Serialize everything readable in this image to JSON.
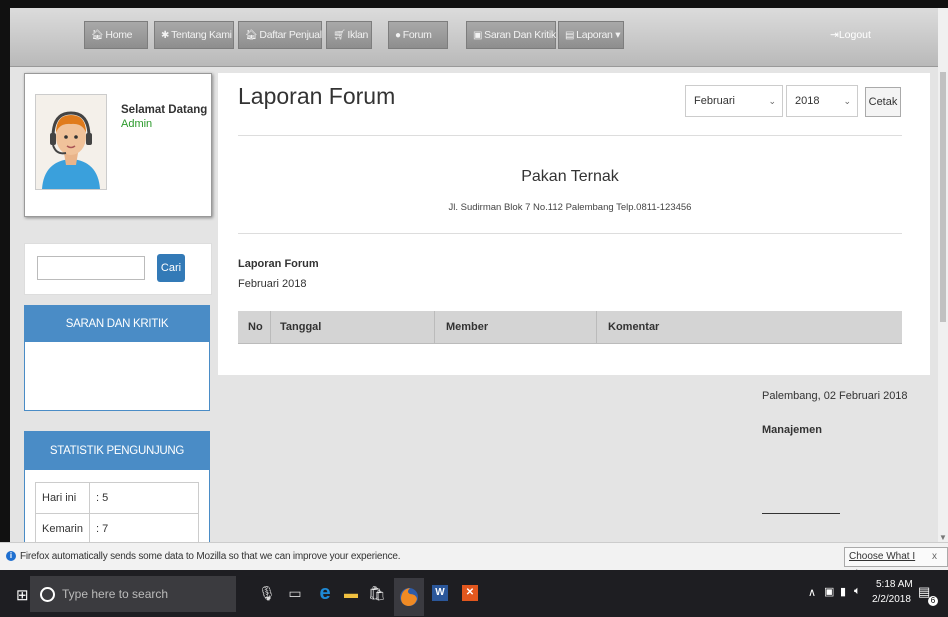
{
  "navbar": {
    "home": "Home",
    "tentang": "Tentang Kami",
    "penjual": "Daftar Penjual",
    "iklan": "Iklan",
    "forum": "Forum",
    "saran": "Saran Dan Kritik",
    "laporan": "Laporan",
    "logout": "Logout"
  },
  "profile": {
    "welcome": "Selamat Datang",
    "role": "Admin"
  },
  "search": {
    "button": "Cari",
    "value": ""
  },
  "saran_panel": {
    "title": "SARAN DAN KRITIK"
  },
  "stat_panel": {
    "title": "STATISTIK PENGUNJUNG",
    "rows": [
      {
        "label": "Hari ini",
        "value": ": 5"
      },
      {
        "label": "Kemarin",
        "value": ": 7"
      }
    ]
  },
  "report": {
    "page_title": "Laporan Forum",
    "month_select": "Februari",
    "year_select": "2018",
    "print_button": "Cetak",
    "company": "Pakan Ternak",
    "address": "Jl. Sudirman Blok 7 No.112 Palembang Telp.0811-123456",
    "title": "Laporan Forum",
    "period": "Februari 2018",
    "columns": [
      "No",
      "Tanggal",
      "Member",
      "Komentar"
    ]
  },
  "signature": {
    "city_date": "Palembang, 02 Februari 2018",
    "role": "Manajemen"
  },
  "notification": {
    "message": "Firefox automatically sends some data to Mozilla so that we can improve your experience.",
    "button": "Choose What I Share",
    "close": "x"
  },
  "taskbar": {
    "search_placeholder": "Type here to search",
    "time": "5:18 AM",
    "date": "2/2/2018",
    "notif_count": "6"
  },
  "colors": {
    "panel_header": "#4a8cc6",
    "admin_green": "#2b9a2b",
    "taskbar": "#1e1e22"
  }
}
